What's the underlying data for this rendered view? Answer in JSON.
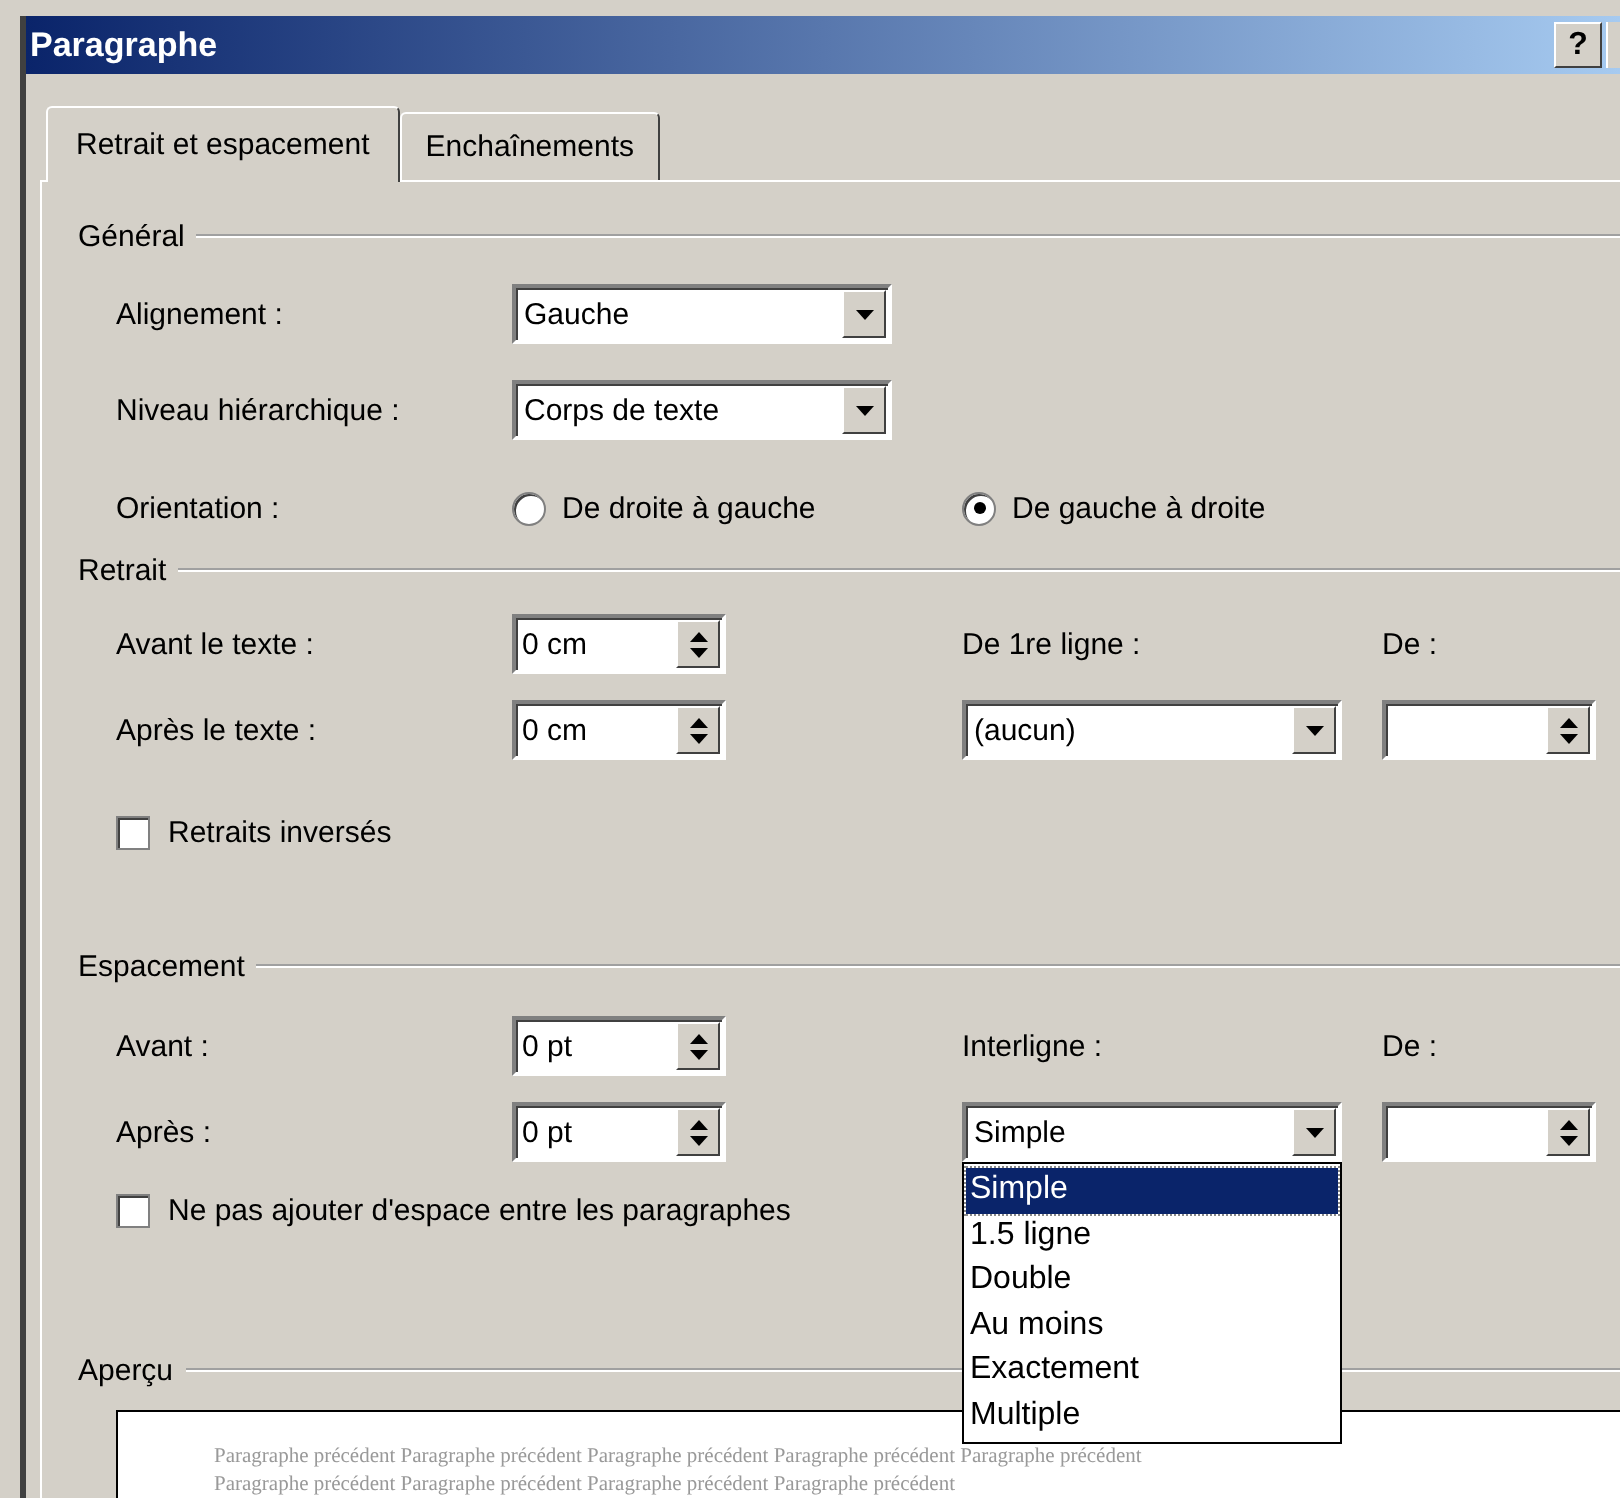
{
  "window": {
    "title": "Paragraphe",
    "help_button": "?"
  },
  "tabs": [
    {
      "label": "Retrait et espacement",
      "selected": true
    },
    {
      "label": "Enchaînements",
      "selected": false
    }
  ],
  "general": {
    "title": "Général",
    "alignment": {
      "label": "Alignement :",
      "value": "Gauche"
    },
    "outline_level": {
      "label": "Niveau hiérarchique :",
      "value": "Corps de texte"
    },
    "orientation": {
      "label": "Orientation :",
      "options": [
        {
          "label": "De droite à gauche",
          "selected": false
        },
        {
          "label": "De gauche à droite",
          "selected": true
        }
      ]
    }
  },
  "indent": {
    "title": "Retrait",
    "before": {
      "label": "Avant le texte :",
      "value": "0 cm"
    },
    "after": {
      "label": "Après le texte :",
      "value": "0 cm"
    },
    "first_line": {
      "label": "De 1re ligne :",
      "value": "(aucun)"
    },
    "by": {
      "label": "De :"
    },
    "mirror": {
      "label": "Retraits inversés",
      "checked": false
    }
  },
  "spacing": {
    "title": "Espacement",
    "before": {
      "label": "Avant :",
      "value": "0 pt"
    },
    "after": {
      "label": "Après :",
      "value": "0 pt"
    },
    "line_spacing": {
      "label": "Interligne :",
      "value": "Simple",
      "expanded": true,
      "options": [
        {
          "label": "Simple",
          "selected": true
        },
        {
          "label": "1.5 ligne",
          "selected": false
        },
        {
          "label": "Double",
          "selected": false
        },
        {
          "label": "Au moins",
          "selected": false
        },
        {
          "label": "Exactement",
          "selected": false
        },
        {
          "label": "Multiple",
          "selected": false
        }
      ]
    },
    "by": {
      "label": "De :"
    },
    "no_space": {
      "label": "Ne pas ajouter d'espace entre les paragraphes",
      "checked": false
    }
  },
  "preview": {
    "title": "Aperçu",
    "lines": [
      [
        "Paragraphe précédent Paragraphe précédent Paragraphe précédent Paragraphe précédent Paragraphe précédent"
      ],
      [
        "Paragraphe précédent Paragraphe précédent Paragraphe précédent Paragraphe précédent"
      ]
    ]
  }
}
